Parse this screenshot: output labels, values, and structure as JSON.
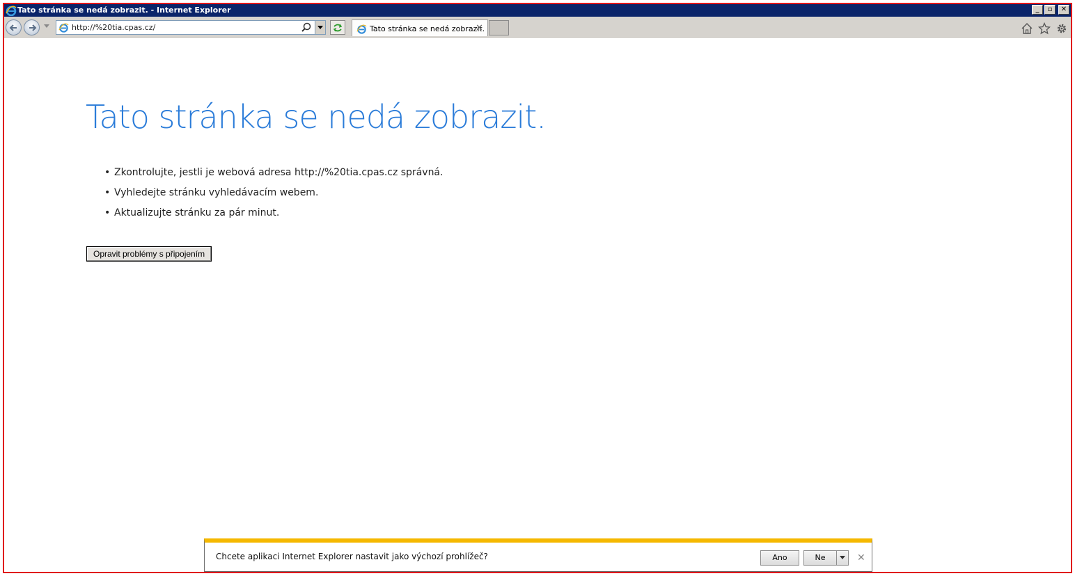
{
  "window": {
    "title": "Tato stránka se nedá zobrazit. - Internet Explorer",
    "buttons": {
      "minimize": "_",
      "restore": "▫",
      "close": "✕"
    }
  },
  "toolbar": {
    "address": {
      "url": "http://%20tia.cpas.cz/"
    },
    "tab": {
      "label": "Tato stránka se nedá zobrazit.",
      "close": "✕"
    },
    "icons": [
      "back-icon",
      "forward-icon",
      "ie-icon",
      "search-icon",
      "refresh-icon",
      "home-icon",
      "star-icon",
      "gear-icon"
    ]
  },
  "content": {
    "title": "Tato stránka se nedá zobrazit.",
    "tips": [
      "Zkontrolujte, jestli je webová adresa http://%20tia.cpas.cz správná.",
      "Vyhledejte stránku vyhledávacím webem.",
      "Aktualizujte stránku za pár minut."
    ],
    "fix_button": "Opravit problémy s připojením"
  },
  "notification": {
    "message": "Chcete aplikaci Internet Explorer nastavit jako výchozí prohlížeč?",
    "yes": "Ano",
    "no": "Ne",
    "close": "✕"
  },
  "colors": {
    "title_bar": "#0a246a",
    "heading_blue": "#2b7cd9",
    "notify_accent": "#f5b800",
    "frame_red": "#e0161b"
  }
}
